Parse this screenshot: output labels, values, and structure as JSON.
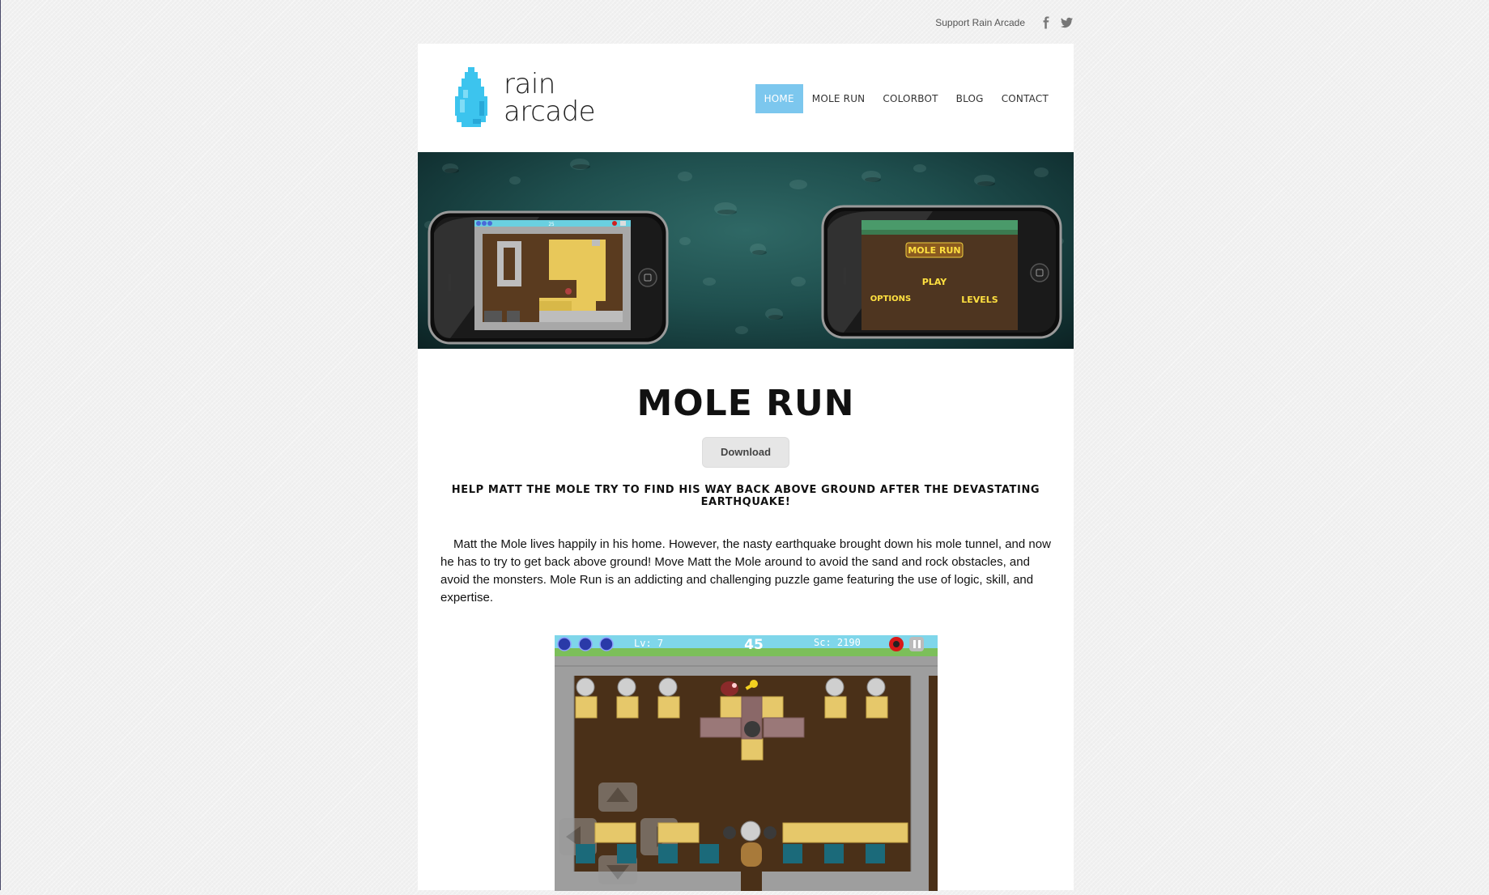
{
  "topbar": {
    "support_label": "Support Rain Arcade",
    "social_icons": [
      "facebook-icon",
      "twitter-icon"
    ]
  },
  "logo": {
    "line1": "rain",
    "line2": "arcade",
    "drop_color": "#3cc4ee"
  },
  "nav": {
    "items": [
      {
        "label": "HOME",
        "active": true
      },
      {
        "label": "MOLE RUN",
        "active": false
      },
      {
        "label": "COLORBOT",
        "active": false
      },
      {
        "label": "BLOG",
        "active": false
      },
      {
        "label": "CONTACT",
        "active": false
      }
    ],
    "active_color": "#7cc7ee"
  },
  "banner": {
    "left_phone": {
      "hud_score": "25"
    },
    "right_phone": {
      "title": "MOLE RUN",
      "play": "PLAY",
      "options": "OPTIONS",
      "levels": "LEVELS"
    }
  },
  "main": {
    "title": "MOLE RUN",
    "download_label": "Download",
    "tagline": "HELP MATT THE MOLE TRY TO FIND HIS WAY BACK ABOVE GROUND AFTER THE DEVASTATING EARTHQUAKE!",
    "description": "Matt the Mole lives happily in his home. However, the nasty earthquake brought down his mole tunnel, and now he has to try to get back above ground! Move Matt the Mole around to avoid the sand and rock obstacles, and avoid the monsters. Mole Run is an addicting and challenging puzzle game featuring the use of logic, skill, and expertise."
  },
  "screenshot": {
    "level_label": "Lv: 7",
    "timer": "45",
    "score_label": "Sc: 2190"
  }
}
